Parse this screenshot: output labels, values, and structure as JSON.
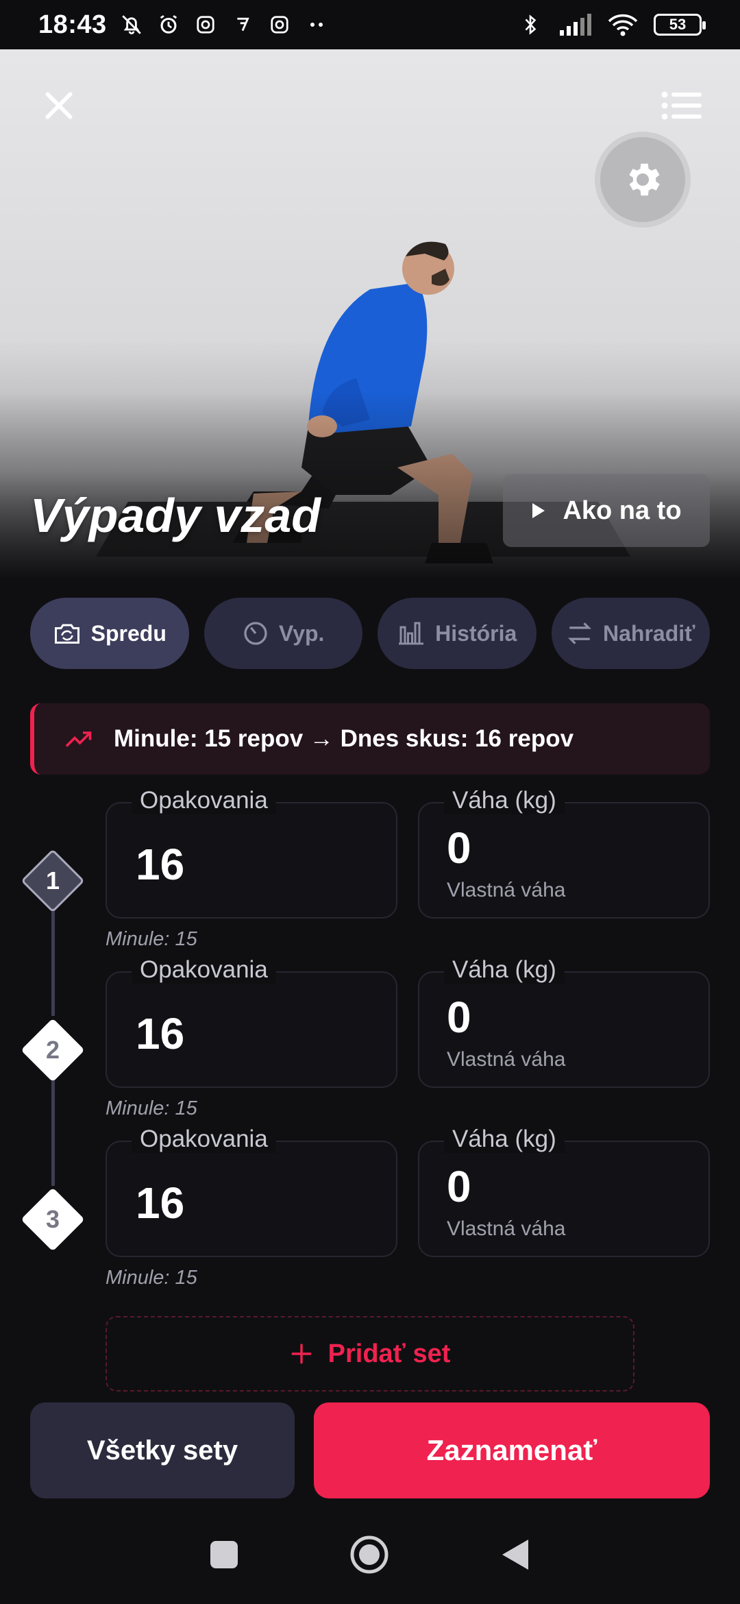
{
  "status_bar": {
    "time": "18:43",
    "battery": "53",
    "left_icons": [
      "bell-off-icon",
      "alarm-icon",
      "instagram-icon",
      "app-icon",
      "instagram-icon",
      "more-dots-icon"
    ],
    "right_icons": [
      "bluetooth-icon",
      "signal-icon",
      "wifi-icon",
      "battery-icon"
    ]
  },
  "hero": {
    "exercise_title": "Výpady vzad",
    "howto_label": "Ako na to"
  },
  "tabs": [
    {
      "label": "Spredu",
      "icon": "camera-rotate-icon",
      "active": true
    },
    {
      "label": "Vyp.",
      "icon": "timer-icon",
      "active": false
    },
    {
      "label": "História",
      "icon": "bar-chart-icon",
      "active": false
    },
    {
      "label": "Nahradiť",
      "icon": "swap-icon",
      "active": false
    }
  ],
  "banner": {
    "text": "Minule: 15 repov → Dnes skus: 16 repov",
    "icon": "trending-up-icon"
  },
  "sets": [
    {
      "number": "1",
      "reps_label": "Opakovania",
      "reps": "16",
      "weight_label": "Váha (kg)",
      "weight": "0",
      "weight_sub": "Vlastná váha",
      "previous": "Minule: 15",
      "active": true
    },
    {
      "number": "2",
      "reps_label": "Opakovania",
      "reps": "16",
      "weight_label": "Váha (kg)",
      "weight": "0",
      "weight_sub": "Vlastná váha",
      "previous": "Minule: 15",
      "active": false
    },
    {
      "number": "3",
      "reps_label": "Opakovania",
      "reps": "16",
      "weight_label": "Váha (kg)",
      "weight": "0",
      "weight_sub": "Vlastná váha",
      "previous": "Minule: 15",
      "active": false
    }
  ],
  "actions": {
    "add_set": "Pridať set",
    "all_sets": "Všetky sety",
    "record": "Zaznamenať"
  },
  "colors": {
    "accent": "#f0224f",
    "background": "#0f0f12",
    "tab_active": "#3d3d5c",
    "tab_inactive": "#2a2a40"
  }
}
